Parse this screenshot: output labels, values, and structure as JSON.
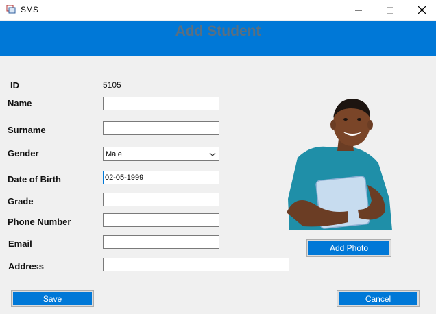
{
  "window": {
    "title": "SMS",
    "icons": {
      "app": "app-icon",
      "minimize": "minimize-icon",
      "maximize": "maximize-icon",
      "close": "close-icon"
    }
  },
  "header": {
    "title": "Add Student"
  },
  "form": {
    "id": {
      "label": "ID",
      "value": "5105"
    },
    "name": {
      "label": "Name",
      "value": ""
    },
    "surname": {
      "label": "Surname",
      "value": ""
    },
    "gender": {
      "label": "Gender",
      "value": "Male"
    },
    "dob": {
      "label": "Date of Birth",
      "value": "02-05-1999"
    },
    "grade": {
      "label": "Grade",
      "value": ""
    },
    "phone": {
      "label": "Phone Number",
      "value": ""
    },
    "email": {
      "label": "Email",
      "value": ""
    },
    "address": {
      "label": "Address",
      "value": ""
    }
  },
  "photo": {
    "add_label": "Add Photo"
  },
  "actions": {
    "save_label": "Save",
    "cancel_label": "Cancel"
  },
  "colors": {
    "accent": "#0078d7",
    "header_title": "#5a6f80",
    "background": "#f0f0f0"
  }
}
